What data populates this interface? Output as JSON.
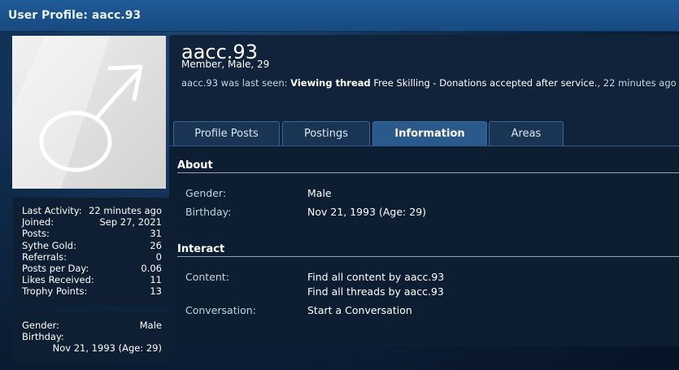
{
  "title": "User Profile: aacc.93",
  "profile": {
    "username": "aacc.93",
    "meta": "Member, Male, 29",
    "last_seen_prefix": "aacc.93 was last seen:",
    "last_seen_action": "Viewing thread",
    "last_seen_thread": "Free Skilling - Donations accepted after service.",
    "last_seen_suffix": ", 22 minutes ago"
  },
  "tabs": [
    "Profile Posts",
    "Postings",
    "Information",
    "Areas"
  ],
  "active_tab": "Information",
  "stats": [
    {
      "k": "Last Activity:",
      "v": "22 minutes ago"
    },
    {
      "k": "Joined:",
      "v": "Sep 27, 2021"
    },
    {
      "k": "Posts:",
      "v": "31"
    },
    {
      "k": "Sythe Gold:",
      "v": "26"
    },
    {
      "k": "Referrals:",
      "v": "0"
    },
    {
      "k": "Posts per Day:",
      "v": "0.06"
    },
    {
      "k": "Likes Received:",
      "v": "11"
    },
    {
      "k": "Trophy Points:",
      "v": "13"
    }
  ],
  "sidebar_info": {
    "gender_label": "Gender:",
    "gender_value": "Male",
    "birthday_label": "Birthday:",
    "birthday_value": "Nov 21, 1993 (Age: 29)"
  },
  "about": {
    "heading": "About",
    "gender_label": "Gender:",
    "gender_value": "Male",
    "birthday_label": "Birthday:",
    "birthday_value": "Nov 21, 1993 (Age: 29)"
  },
  "interact": {
    "heading": "Interact",
    "content_label": "Content:",
    "content_link_1": "Find all content by aacc.93",
    "content_link_2": "Find all threads by aacc.93",
    "conversation_label": "Conversation:",
    "conversation_link": "Start a Conversation"
  },
  "colors": {
    "title_bar": "#1f5a98",
    "active_tab": "#2a5a8c",
    "panel": "#10233a"
  }
}
